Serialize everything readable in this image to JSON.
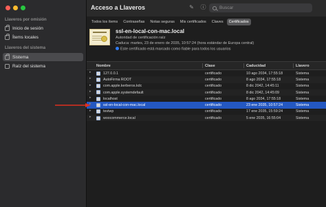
{
  "sidebar": {
    "section1_title": "Llaveros por omisión",
    "section1_items": [
      {
        "label": "Inicio de sesión",
        "icon": "lock-icon"
      },
      {
        "label": "Ítems locales",
        "icon": "lock-icon"
      }
    ],
    "section2_title": "Llaveros del sistema",
    "section2_items": [
      {
        "label": "Sistema",
        "icon": "lock-icon",
        "selected": true
      },
      {
        "label": "Raíz del sistema",
        "icon": "cabinet-icon",
        "selected": false
      }
    ]
  },
  "toolbar": {
    "title": "Acceso a Llaveros",
    "search_placeholder": "Buscar"
  },
  "tabs": [
    "Todos los ítems",
    "Contraseñas",
    "Notas seguras",
    "Mis certificados",
    "Claves",
    "Certificados"
  ],
  "active_tab": "Certificados",
  "certificate": {
    "name": "ssl-en-local-con-mac.local",
    "kind": "Autoridad de certificación raíz",
    "expires": "Caduca: martes, 23 de enero de 2035, 10:57:24 (hora estándar de Europa central)",
    "trust": "Este certificado está marcado como fiable para todos los usuarios"
  },
  "table": {
    "headers": {
      "name": "Nombre",
      "kind": "Clase",
      "expires": "Caducidad",
      "keychain": "Llavero"
    },
    "rows": [
      {
        "name": "127.0.0.1",
        "kind": "certificado",
        "expires": "10 ago 2034, 17:55:18",
        "keychain": "Sistema"
      },
      {
        "name": "AutoFirma ROOT",
        "kind": "certificado",
        "expires": "8 ago 2034, 17:55:18",
        "keychain": "Sistema"
      },
      {
        "name": "com.apple.kerberos.kdc",
        "kind": "certificado",
        "expires": "8 dic 2042, 14:45:11",
        "keychain": "Sistema"
      },
      {
        "name": "com.apple.systemdefault",
        "kind": "certificado",
        "expires": "8 dic 2042, 14:45:09",
        "keychain": "Sistema"
      },
      {
        "name": "localhost",
        "kind": "certificado",
        "expires": "8 ago 2034, 17:55:18",
        "keychain": "Sistema"
      },
      {
        "name": "ssl-en-local-con-mac.local",
        "kind": "certificado",
        "expires": "23 ene 2035, 10:57:24",
        "keychain": "Sistema",
        "selected": true
      },
      {
        "name": "testwp",
        "kind": "certificado",
        "expires": "17 ene 2035, 15:59:24",
        "keychain": "Sistema"
      },
      {
        "name": "woocommerce.local",
        "kind": "certificado",
        "expires": "5 ene 2035, 16:55:04",
        "keychain": "Sistema"
      }
    ]
  },
  "colors": {
    "selection": "#2458c2",
    "arrow": "#e0301e"
  }
}
